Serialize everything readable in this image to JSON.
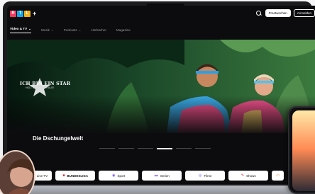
{
  "brand": {
    "letters": [
      "R",
      "T",
      "L"
    ],
    "plus": "+",
    "colors": [
      "#f43a5c",
      "#19a8e5",
      "#f2b21f"
    ]
  },
  "topbar": {
    "search_icon": "search-icon",
    "free_week_label": "Freetwochen",
    "login_label": "Anmelden"
  },
  "nav": {
    "items": [
      {
        "label": "Video & TV",
        "chevron": "⌄",
        "active": true
      },
      {
        "label": "Musik",
        "chevron": "⌄",
        "active": false
      },
      {
        "label": "Podcasts",
        "chevron": "⌄",
        "active": false
      },
      {
        "label": "Hörbücher",
        "chevron": "",
        "active": false
      },
      {
        "label": "Magazine",
        "chevron": "",
        "active": false
      }
    ]
  },
  "hero": {
    "show_title": "ICH BIN EIN STAR",
    "show_subtitle": "HOLT MICH HIER RAUS!",
    "headline": "Die Dschungelwelt",
    "carousel_count": 6,
    "carousel_active": 3
  },
  "categories": [
    {
      "label": "Live-TV",
      "icon": "tv-icon",
      "glyph": "▭"
    },
    {
      "label": "BUNDESLIGA",
      "icon": "bundesliga-icon",
      "glyph": "■"
    },
    {
      "label": "Sport",
      "icon": "ball-icon",
      "glyph": "◉"
    },
    {
      "label": "Serien",
      "icon": "series-icon",
      "glyph": "▬"
    },
    {
      "label": "Filme",
      "icon": "film-icon",
      "glyph": "◎"
    },
    {
      "label": "Shows",
      "icon": "wand-icon",
      "glyph": "✎"
    },
    {
      "label": "",
      "icon": "more-icon",
      "glyph": "▭"
    }
  ]
}
